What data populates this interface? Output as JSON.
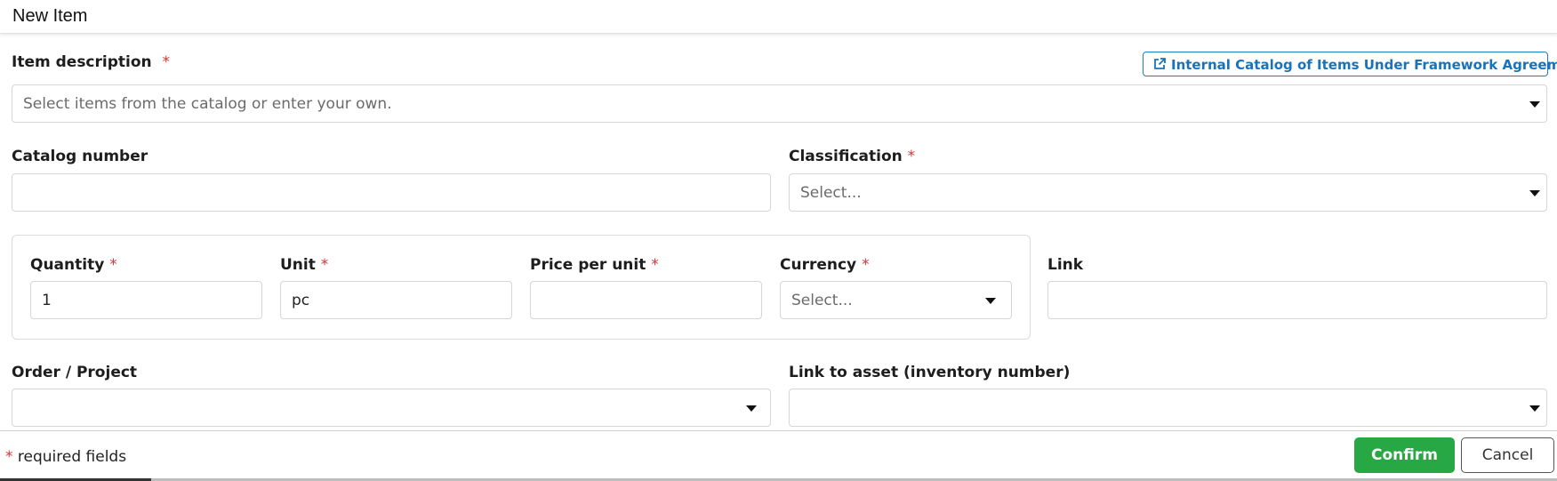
{
  "dialog": {
    "title": "New Item"
  },
  "item_description": {
    "label": "Item description",
    "required_mark": "*",
    "placeholder": "Select items from the catalog or enter your own."
  },
  "catalog_link": {
    "label": "Internal Catalog of Items Under Framework Agreements",
    "icon": "external-link-icon"
  },
  "catalog_number": {
    "label": "Catalog number",
    "value": ""
  },
  "classification": {
    "label": "Classification",
    "required_mark": "*",
    "placeholder": "Select..."
  },
  "quantity": {
    "label": "Quantity",
    "required_mark": "*",
    "value": "1"
  },
  "unit": {
    "label": "Unit",
    "required_mark": "*",
    "value": "pc"
  },
  "price_per_unit": {
    "label": "Price per unit",
    "required_mark": "*",
    "value": ""
  },
  "currency": {
    "label": "Currency",
    "required_mark": "*",
    "placeholder": "Select..."
  },
  "link": {
    "label": "Link",
    "value": ""
  },
  "order_project": {
    "label": "Order / Project",
    "value": ""
  },
  "asset_link": {
    "label": "Link to asset (inventory number)",
    "value": ""
  },
  "footer": {
    "required_mark": "*",
    "required_note": "required fields",
    "confirm_label": "Confirm",
    "cancel_label": "Cancel"
  },
  "colors": {
    "accent": "#1a73b8",
    "confirm": "#28a745",
    "required": "#e03030"
  }
}
